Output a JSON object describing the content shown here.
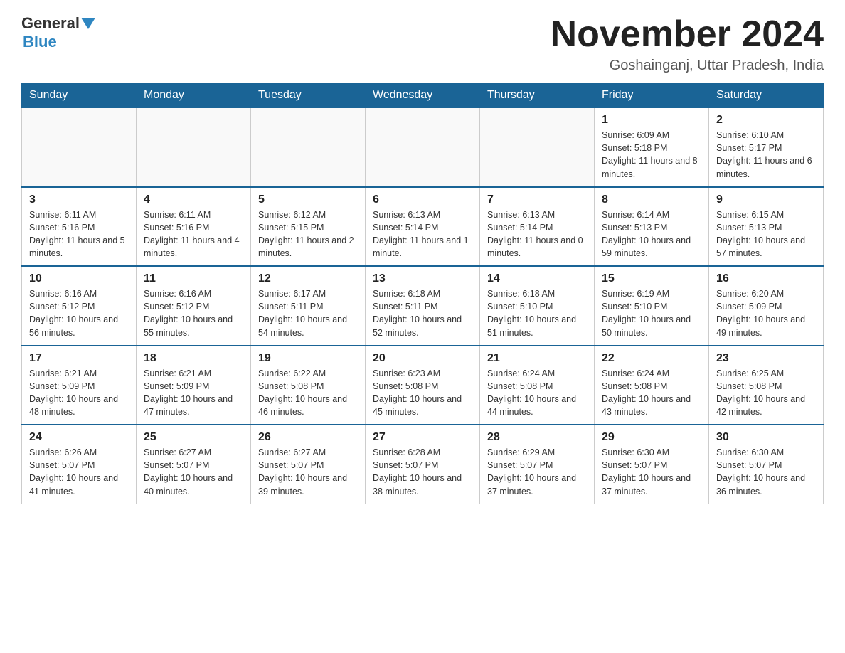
{
  "header": {
    "logo_general": "General",
    "logo_blue": "Blue",
    "month_year": "November 2024",
    "location": "Goshainganj, Uttar Pradesh, India"
  },
  "weekdays": [
    "Sunday",
    "Monday",
    "Tuesday",
    "Wednesday",
    "Thursday",
    "Friday",
    "Saturday"
  ],
  "weeks": [
    [
      {
        "day": "",
        "info": ""
      },
      {
        "day": "",
        "info": ""
      },
      {
        "day": "",
        "info": ""
      },
      {
        "day": "",
        "info": ""
      },
      {
        "day": "",
        "info": ""
      },
      {
        "day": "1",
        "info": "Sunrise: 6:09 AM\nSunset: 5:18 PM\nDaylight: 11 hours and 8 minutes."
      },
      {
        "day": "2",
        "info": "Sunrise: 6:10 AM\nSunset: 5:17 PM\nDaylight: 11 hours and 6 minutes."
      }
    ],
    [
      {
        "day": "3",
        "info": "Sunrise: 6:11 AM\nSunset: 5:16 PM\nDaylight: 11 hours and 5 minutes."
      },
      {
        "day": "4",
        "info": "Sunrise: 6:11 AM\nSunset: 5:16 PM\nDaylight: 11 hours and 4 minutes."
      },
      {
        "day": "5",
        "info": "Sunrise: 6:12 AM\nSunset: 5:15 PM\nDaylight: 11 hours and 2 minutes."
      },
      {
        "day": "6",
        "info": "Sunrise: 6:13 AM\nSunset: 5:14 PM\nDaylight: 11 hours and 1 minute."
      },
      {
        "day": "7",
        "info": "Sunrise: 6:13 AM\nSunset: 5:14 PM\nDaylight: 11 hours and 0 minutes."
      },
      {
        "day": "8",
        "info": "Sunrise: 6:14 AM\nSunset: 5:13 PM\nDaylight: 10 hours and 59 minutes."
      },
      {
        "day": "9",
        "info": "Sunrise: 6:15 AM\nSunset: 5:13 PM\nDaylight: 10 hours and 57 minutes."
      }
    ],
    [
      {
        "day": "10",
        "info": "Sunrise: 6:16 AM\nSunset: 5:12 PM\nDaylight: 10 hours and 56 minutes."
      },
      {
        "day": "11",
        "info": "Sunrise: 6:16 AM\nSunset: 5:12 PM\nDaylight: 10 hours and 55 minutes."
      },
      {
        "day": "12",
        "info": "Sunrise: 6:17 AM\nSunset: 5:11 PM\nDaylight: 10 hours and 54 minutes."
      },
      {
        "day": "13",
        "info": "Sunrise: 6:18 AM\nSunset: 5:11 PM\nDaylight: 10 hours and 52 minutes."
      },
      {
        "day": "14",
        "info": "Sunrise: 6:18 AM\nSunset: 5:10 PM\nDaylight: 10 hours and 51 minutes."
      },
      {
        "day": "15",
        "info": "Sunrise: 6:19 AM\nSunset: 5:10 PM\nDaylight: 10 hours and 50 minutes."
      },
      {
        "day": "16",
        "info": "Sunrise: 6:20 AM\nSunset: 5:09 PM\nDaylight: 10 hours and 49 minutes."
      }
    ],
    [
      {
        "day": "17",
        "info": "Sunrise: 6:21 AM\nSunset: 5:09 PM\nDaylight: 10 hours and 48 minutes."
      },
      {
        "day": "18",
        "info": "Sunrise: 6:21 AM\nSunset: 5:09 PM\nDaylight: 10 hours and 47 minutes."
      },
      {
        "day": "19",
        "info": "Sunrise: 6:22 AM\nSunset: 5:08 PM\nDaylight: 10 hours and 46 minutes."
      },
      {
        "day": "20",
        "info": "Sunrise: 6:23 AM\nSunset: 5:08 PM\nDaylight: 10 hours and 45 minutes."
      },
      {
        "day": "21",
        "info": "Sunrise: 6:24 AM\nSunset: 5:08 PM\nDaylight: 10 hours and 44 minutes."
      },
      {
        "day": "22",
        "info": "Sunrise: 6:24 AM\nSunset: 5:08 PM\nDaylight: 10 hours and 43 minutes."
      },
      {
        "day": "23",
        "info": "Sunrise: 6:25 AM\nSunset: 5:08 PM\nDaylight: 10 hours and 42 minutes."
      }
    ],
    [
      {
        "day": "24",
        "info": "Sunrise: 6:26 AM\nSunset: 5:07 PM\nDaylight: 10 hours and 41 minutes."
      },
      {
        "day": "25",
        "info": "Sunrise: 6:27 AM\nSunset: 5:07 PM\nDaylight: 10 hours and 40 minutes."
      },
      {
        "day": "26",
        "info": "Sunrise: 6:27 AM\nSunset: 5:07 PM\nDaylight: 10 hours and 39 minutes."
      },
      {
        "day": "27",
        "info": "Sunrise: 6:28 AM\nSunset: 5:07 PM\nDaylight: 10 hours and 38 minutes."
      },
      {
        "day": "28",
        "info": "Sunrise: 6:29 AM\nSunset: 5:07 PM\nDaylight: 10 hours and 37 minutes."
      },
      {
        "day": "29",
        "info": "Sunrise: 6:30 AM\nSunset: 5:07 PM\nDaylight: 10 hours and 37 minutes."
      },
      {
        "day": "30",
        "info": "Sunrise: 6:30 AM\nSunset: 5:07 PM\nDaylight: 10 hours and 36 minutes."
      }
    ]
  ]
}
